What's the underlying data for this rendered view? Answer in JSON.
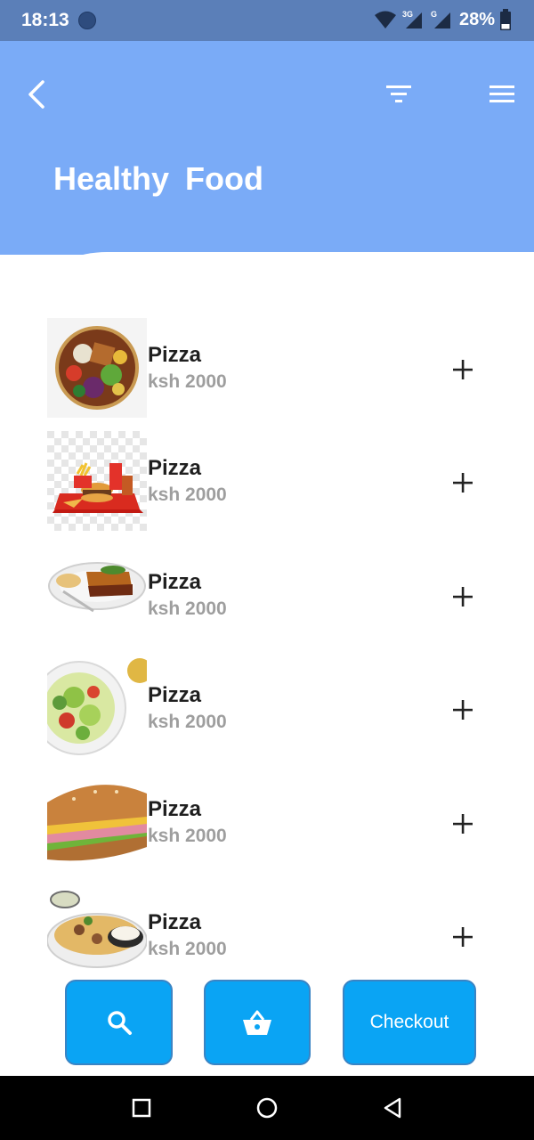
{
  "status_bar": {
    "time": "18:13",
    "battery_percent": "28%",
    "network_labels": [
      "3G",
      "G"
    ]
  },
  "header": {
    "title": "Healthy  Food",
    "background_color": "#7aabf7",
    "icons": [
      "back-arrow-icon",
      "filter-icon",
      "menu-icon"
    ]
  },
  "products": [
    {
      "name": "Pizza",
      "price": "ksh 2000",
      "image": "salad-bowl"
    },
    {
      "name": "Pizza",
      "price": "ksh 2000",
      "image": "burger-fries-tray"
    },
    {
      "name": "Pizza",
      "price": "ksh 2000",
      "image": "lasagna-plate"
    },
    {
      "name": "Pizza",
      "price": "ksh 2000",
      "image": "green-salad-plate"
    },
    {
      "name": "Pizza",
      "price": "ksh 2000",
      "image": "sub-sandwich"
    },
    {
      "name": "Pizza",
      "price": "ksh 2000",
      "image": "nachos-plate"
    }
  ],
  "bottom_buttons": {
    "search_icon": "search-icon",
    "basket_icon": "basket-icon",
    "checkout_label": "Checkout",
    "button_color": "#0aa4f4"
  },
  "nav_bar": {
    "icons": [
      "recents-square-icon",
      "home-circle-icon",
      "back-triangle-icon"
    ]
  }
}
